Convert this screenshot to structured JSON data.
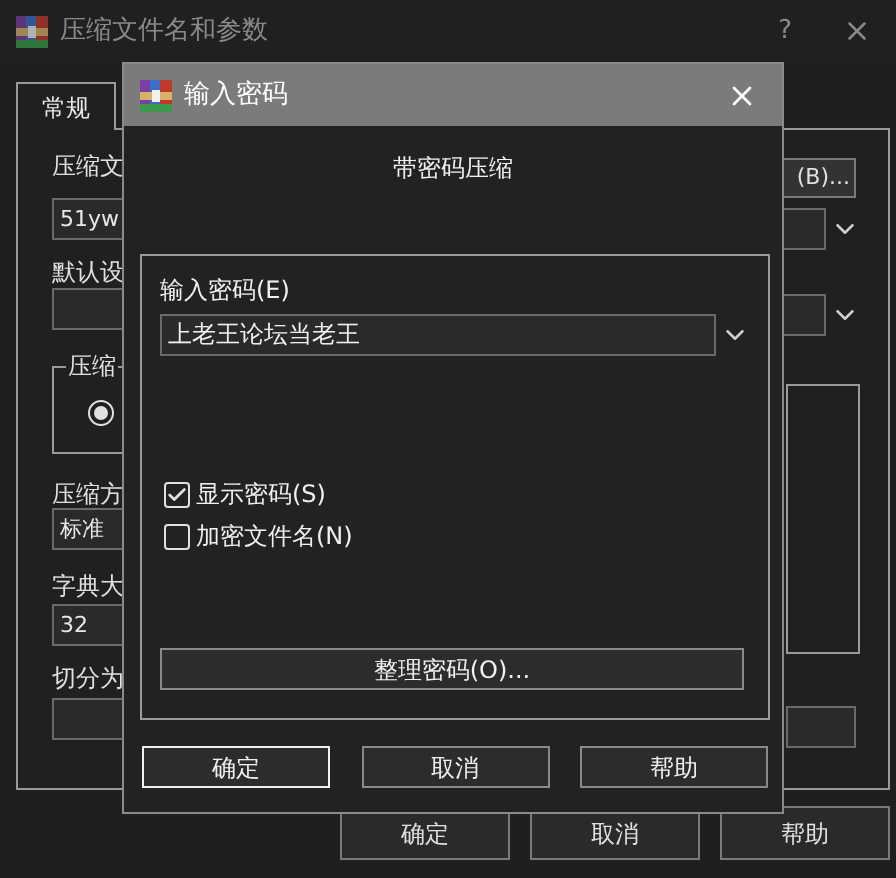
{
  "main_window": {
    "title": "压缩文件名和参数",
    "help": "?",
    "tabs": [
      {
        "label": "常规",
        "selected": true
      }
    ],
    "left_column": [
      {
        "kind": "label",
        "text": "压缩文"
      },
      {
        "kind": "field",
        "value": "51yw"
      },
      {
        "kind": "label",
        "text": "默认设"
      },
      {
        "kind": "field"
      },
      {
        "kind": "group",
        "legend": "压缩",
        "radio_selected": true
      },
      {
        "kind": "label",
        "text": "压缩方"
      },
      {
        "kind": "field",
        "value": "标准"
      },
      {
        "kind": "label",
        "text": "字典大"
      },
      {
        "kind": "field",
        "value": "32"
      },
      {
        "kind": "label",
        "text": "切分为"
      },
      {
        "kind": "field"
      }
    ],
    "right_column": [
      {
        "kind": "button",
        "label": "(B)..."
      },
      {
        "kind": "combo"
      },
      {
        "kind": "combo"
      },
      {
        "kind": "group"
      },
      {
        "kind": "field"
      }
    ],
    "buttons": [
      "确定",
      "取消",
      "帮助"
    ]
  },
  "dialog": {
    "title": "输入密码",
    "heading": "带密码压缩",
    "password_label": "输入密码(E)",
    "password_value": "上老王论坛当老王",
    "options": [
      {
        "label": "显示密码(S)",
        "checked": true
      },
      {
        "label": "加密文件名(N)",
        "checked": false
      }
    ],
    "organize_button": "整理密码(O)...",
    "buttons": [
      {
        "label": "确定",
        "default": true
      },
      {
        "label": "取消",
        "default": false
      },
      {
        "label": "帮助",
        "default": false
      }
    ]
  }
}
